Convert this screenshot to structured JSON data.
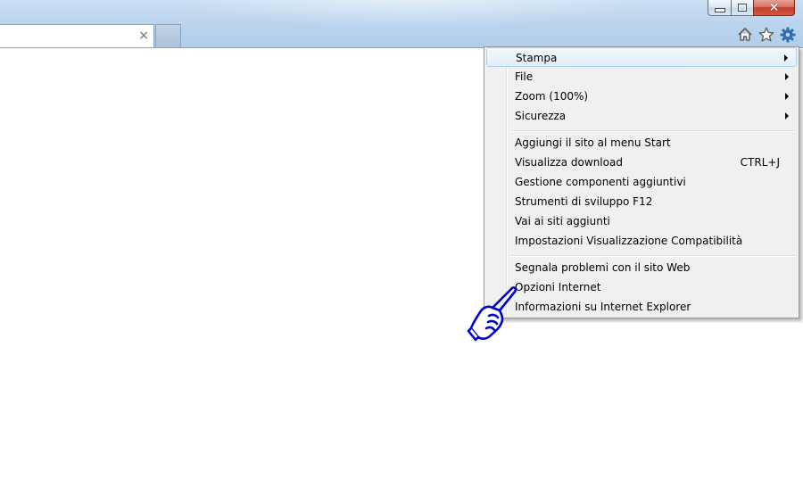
{
  "window": {
    "controls": {
      "minimize_icon": "minimize-icon",
      "maximize_icon": "restore-icon",
      "close_glyph": "✕"
    }
  },
  "tab": {
    "close_glyph": "×"
  },
  "toolbar": {
    "home_icon": "home-icon",
    "favorites_icon": "star-icon",
    "tools_icon": "gear-icon",
    "accent_color": "#2e6db4"
  },
  "menu": {
    "group1": [
      {
        "label": "Stampa",
        "submenu": true,
        "highlighted": true
      },
      {
        "label": "File",
        "submenu": true
      },
      {
        "label": "Zoom (100%)",
        "submenu": true
      },
      {
        "label": "Sicurezza",
        "submenu": true
      }
    ],
    "group2": [
      {
        "label": "Aggiungi il sito al menu Start"
      },
      {
        "label": "Visualizza download",
        "shortcut": "CTRL+J"
      },
      {
        "label": "Gestione componenti aggiuntivi"
      },
      {
        "label": "Strumenti di sviluppo F12"
      },
      {
        "label": "Vai ai siti aggiunti"
      },
      {
        "label": "Impostazioni Visualizzazione Compatibilità"
      }
    ],
    "group3": [
      {
        "label": "Segnala problemi con il sito Web"
      },
      {
        "label": "Opzioni Internet"
      },
      {
        "label": "Informazioni su Internet Explorer"
      }
    ]
  },
  "pointer": {
    "icon": "pointing-hand-icon",
    "color": "#0000cc"
  }
}
